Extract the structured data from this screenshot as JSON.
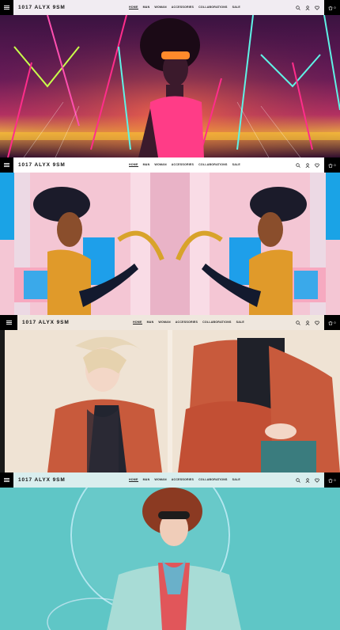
{
  "brand": {
    "logo": "1017 ALYX 9SM"
  },
  "nav": {
    "links": [
      "HOME",
      "MAN",
      "WOMAN",
      "ACCESSORIES",
      "COLLABORATIONS",
      "SALE"
    ],
    "active": "HOME"
  },
  "cart": {
    "count": "0"
  },
  "icons": [
    "menu-icon",
    "search-icon",
    "account-icon",
    "wishlist-icon",
    "cart-icon"
  ],
  "colors": {
    "bar_black": "#000000",
    "neon_pink": "#ff2d8b",
    "neon_teal": "#5ff2e6",
    "coral": "#c85a3c",
    "teal_bg": "#5fc6c6"
  }
}
